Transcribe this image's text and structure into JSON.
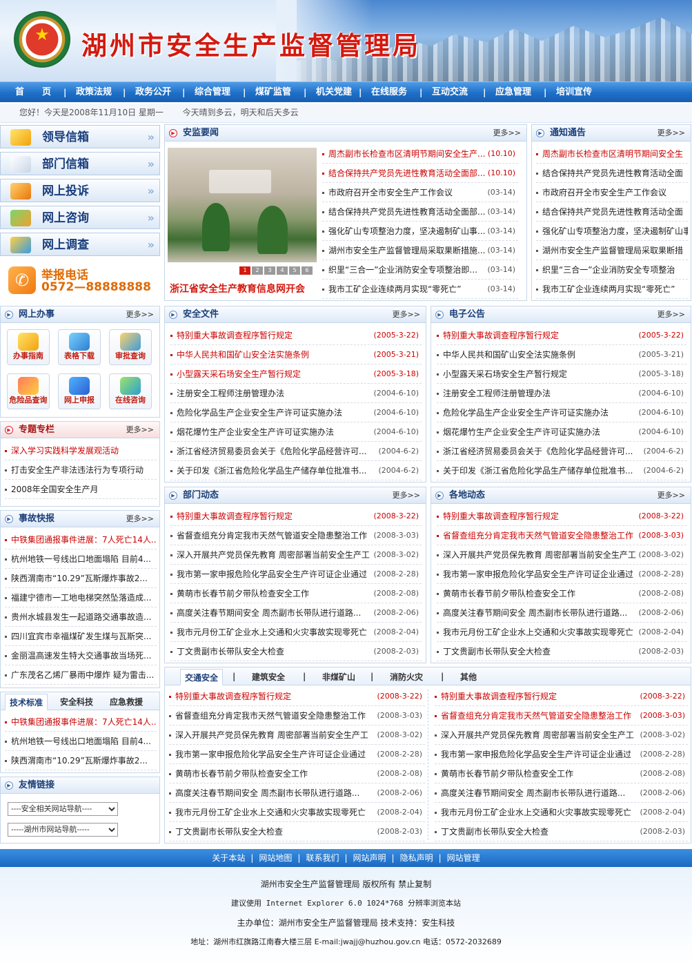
{
  "header": {
    "title": "湖州市安全生产监督管理局",
    "emblem_text": "Zhejiang Administration of Work Safety"
  },
  "nav": [
    "首　　页",
    "政策法规",
    "政务公开",
    "综合管理",
    "煤矿监管",
    "机关党建",
    "在线服务",
    "互动交流",
    "应急管理",
    "培训宣传"
  ],
  "greeting": {
    "hello": "您好！今天是2008年11月10日  星期一",
    "weather": "今天晴到多云，明天和后天多云"
  },
  "left_buttons": [
    "领导信箱",
    "部门信箱",
    "网上投诉",
    "网上咨询",
    "网上调查"
  ],
  "hotline": {
    "label": "举报电话",
    "number": "0572—88888888"
  },
  "more": "更多>>",
  "online_service": {
    "title": "网上办事",
    "items": [
      "办事指南",
      "表格下载",
      "审批查询",
      "危险品查询",
      "网上申报",
      "在线咨询"
    ]
  },
  "special": {
    "title": "专题专栏",
    "items": [
      "深入学习实践科学发展观活动",
      "打击安全生产非法违法行为专项行动",
      "2008年全国安全生产月"
    ]
  },
  "accident": {
    "title": "事故快报",
    "items": [
      "中铁集团通报事件进展：7人死亡14人...",
      "杭州地铁一号线出口地面塌陷  目前4...",
      "陕西渭南市“10.29”瓦斯爆炸事故2...",
      "福建宁德市一工地电梯突然坠落造成...",
      "贵州水城县发生一起道路交通事故造...",
      "四川宜宾市幸福煤矿发生煤与瓦斯突...",
      "金丽温高速发生特大交通事故当场死...",
      "广东茂名乙烯厂暴雨中爆炸  疑为雷击..."
    ]
  },
  "tech": {
    "tabs": [
      "技术标准",
      "安全科技",
      "应急救援"
    ],
    "items": [
      "中铁集团通报事件进展：7人死亡14人...",
      "杭州地铁一号线出口地面塌陷  目前4...",
      "陕西渭南市“10.29”瓦斯爆炸事故2..."
    ]
  },
  "links": {
    "title": "友情链接",
    "select1": "----安全相关网站导航----",
    "select2": "-----湖州市网站导航-----"
  },
  "news": {
    "title": "安监要闻",
    "photo_caption": "浙江省安全生产教育信息网开会",
    "pager": [
      "1",
      "2",
      "3",
      "4",
      "5",
      "6"
    ],
    "items": [
      {
        "text": "周杰副市长检查市区清明节期间安全生产...",
        "date": "(10.10)"
      },
      {
        "text": "结合保持共产党员先进性教育活动全面部...",
        "date": "(10.10)"
      },
      {
        "text": "市政府召开全市安全生产工作会议",
        "date": "(03-14)"
      },
      {
        "text": "结合保持共产党员先进性教育活动全面部...",
        "date": "(03-14)"
      },
      {
        "text": "强化矿山专项整治力度，坚决遏制矿山事...",
        "date": "(03-14)"
      },
      {
        "text": "湖州市安全生产监督管理局采取果断措施...",
        "date": "(03-14)"
      },
      {
        "text": "织里“三合一”企业消防安全专项整治即...",
        "date": "(03-14)"
      },
      {
        "text": "我市工矿企业连续两月实现“零死亡”",
        "date": "(03-14)"
      }
    ]
  },
  "notice": {
    "title": "通知通告",
    "items": [
      "周杰副市长检查市区清明节期间安全生",
      "结合保持共产党员先进性教育活动全面",
      "市政府召开全市安全生产工作会议",
      "结合保持共产党员先进性教育活动全面",
      "强化矿山专项整治力度，坚决遏制矿山事",
      "湖州市安全生产监督管理局采取果断措",
      "织里“三合一”企业消防安全专项整治",
      "我市工矿企业连续两月实现“零死亡”"
    ]
  },
  "safety_docs": {
    "title": "安全文件",
    "items": [
      {
        "text": "特别重大事故调查程序暂行规定",
        "date": "(2005-3-22)"
      },
      {
        "text": "中华人民共和国矿山安全法实施条例",
        "date": "(2005-3-21)"
      },
      {
        "text": "小型露天采石场安全生产暂行规定",
        "date": "(2005-3-18)"
      },
      {
        "text": "注册安全工程师注册管理办法",
        "date": "(2004-6-10)"
      },
      {
        "text": "危险化学品生产企业安全生产许可证实施办法",
        "date": "(2004-6-10)"
      },
      {
        "text": "烟花爆竹生产企业安全生产许可证实施办法",
        "date": "(2004-6-10)"
      },
      {
        "text": "浙江省经济贸易委员会关于《危险化学品经营许可...",
        "date": "(2004-6-2)"
      },
      {
        "text": "关于印发《浙江省危险化学品生产储存单位批准书...",
        "date": "(2004-6-2)"
      }
    ]
  },
  "e_notice": {
    "title": "电子公告",
    "items": [
      {
        "text": "特别重大事故调查程序暂行规定",
        "date": "(2005-3-22)"
      },
      {
        "text": "中华人民共和国矿山安全法实施条例",
        "date": "(2005-3-21)"
      },
      {
        "text": "小型露天采石场安全生产暂行规定",
        "date": "(2005-3-18)"
      },
      {
        "text": "注册安全工程师注册管理办法",
        "date": "(2004-6-10)"
      },
      {
        "text": "危险化学品生产企业安全生产许可证实施办法",
        "date": "(2004-6-10)"
      },
      {
        "text": "烟花爆竹生产企业安全生产许可证实施办法",
        "date": "(2004-6-10)"
      },
      {
        "text": "浙江省经济贸易委员会关于《危险化学品经营许可...",
        "date": "(2004-6-2)"
      },
      {
        "text": "关于印发《浙江省危险化学品生产储存单位批准书...",
        "date": "(2004-6-2)"
      }
    ]
  },
  "dept_news": {
    "title": "部门动态",
    "items": [
      {
        "text": "特别重大事故调查程序暂行规定",
        "date": "(2008-3-22)"
      },
      {
        "text": "省督查组充分肯定我市天然气管道安全隐患整治工作",
        "date": "(2008-3-03)"
      },
      {
        "text": "深入开展共产党员保先教育  周密部署当前安全生产工",
        "date": "(2008-3-02)"
      },
      {
        "text": "我市第一家申报危险化学品安全生产许可证企业通过",
        "date": "(2008-2-28)"
      },
      {
        "text": "黄萌市长春节前夕带队检查安全工作",
        "date": "(2008-2-08)"
      },
      {
        "text": "高度关注春节期间安全  周杰副市长带队进行道路...",
        "date": "(2008-2-06)"
      },
      {
        "text": "我市元月份工矿企业水上交通和火灾事故实现零死亡",
        "date": "(2008-2-04)"
      },
      {
        "text": "丁文贵副市长带队安全大检查",
        "date": "(2008-2-03)"
      }
    ]
  },
  "local_news": {
    "title": "各地动态",
    "items": [
      {
        "text": "特别重大事故调查程序暂行规定",
        "date": "(2008-3-22)"
      },
      {
        "text": "省督查组充分肯定我市天然气管道安全隐患整治工作",
        "date": "(2008-3-03)"
      },
      {
        "text": "深入开展共产党员保先教育  周密部署当前安全生产工",
        "date": "(2008-3-02)"
      },
      {
        "text": "我市第一家申报危险化学品安全生产许可证企业通过",
        "date": "(2008-2-28)"
      },
      {
        "text": "黄萌市长春节前夕带队检查安全工作",
        "date": "(2008-2-08)"
      },
      {
        "text": "高度关注春节期间安全  周杰副市长带队进行道路...",
        "date": "(2008-2-06)"
      },
      {
        "text": "我市元月份工矿企业水上交通和火灾事故实现零死亡",
        "date": "(2008-2-04)"
      },
      {
        "text": "丁文贵副市长带队安全大检查",
        "date": "(2008-2-03)"
      }
    ]
  },
  "category": {
    "tabs": [
      "交通安全",
      "建筑安全",
      "非煤矿山",
      "消防火灾",
      "其他"
    ],
    "left": [
      {
        "text": "特别重大事故调查程序暂行规定",
        "date": "(2008-3-22)"
      },
      {
        "text": "省督查组充分肯定我市天然气管道安全隐患整治工作",
        "date": "(2008-3-03)"
      },
      {
        "text": "深入开展共产党员保先教育  周密部署当前安全生产工",
        "date": "(2008-3-02)"
      },
      {
        "text": "我市第一家申报危险化学品安全生产许可证企业通过",
        "date": "(2008-2-28)"
      },
      {
        "text": "黄萌市长春节前夕带队检查安全工作",
        "date": "(2008-2-08)"
      },
      {
        "text": "高度关注春节期间安全  周杰副市长带队进行道路...",
        "date": "(2008-2-06)"
      },
      {
        "text": "我市元月份工矿企业水上交通和火灾事故实现零死亡",
        "date": "(2008-2-04)"
      },
      {
        "text": "丁文贵副市长带队安全大检查",
        "date": "(2008-2-03)"
      }
    ],
    "right": [
      {
        "text": "特别重大事故调查程序暂行规定",
        "date": "(2008-3-22)"
      },
      {
        "text": "省督查组充分肯定我市天然气管道安全隐患整治工作",
        "date": "(2008-3-03)"
      },
      {
        "text": "深入开展共产党员保先教育  周密部署当前安全生产工",
        "date": "(2008-3-02)"
      },
      {
        "text": "我市第一家申报危险化学品安全生产许可证企业通过",
        "date": "(2008-2-28)"
      },
      {
        "text": "黄萌市长春节前夕带队检查安全工作",
        "date": "(2008-2-08)"
      },
      {
        "text": "高度关注春节期间安全  周杰副市长带队进行道路...",
        "date": "(2008-2-06)"
      },
      {
        "text": "我市元月份工矿企业水上交通和火灾事故实现零死亡",
        "date": "(2008-2-04)"
      },
      {
        "text": "丁文贵副市长带队安全大检查",
        "date": "(2008-2-03)"
      }
    ]
  },
  "footer": {
    "links": [
      "关于本站",
      "网站地图",
      "联系我们",
      "网站声明",
      "隐私声明",
      "网站管理"
    ],
    "copyright": "湖州市安全生产监督管理局  版权所有  禁止复制",
    "browser": "建议使用 Internet Explorer 6.0 1024*768 分辨率浏览本站",
    "host": "主办单位：湖州市安全生产监督管理局    技术支持：安生科技",
    "address": "地址：湖州市红旗路江南春大楼三层    E-mail:jwajj@huzhou.gov.cn    电话：0572-2032689"
  },
  "colors": {
    "accent_blue": "#1e6fc8",
    "title_red": "#d4190f",
    "highlight_red": "#cc0000"
  }
}
